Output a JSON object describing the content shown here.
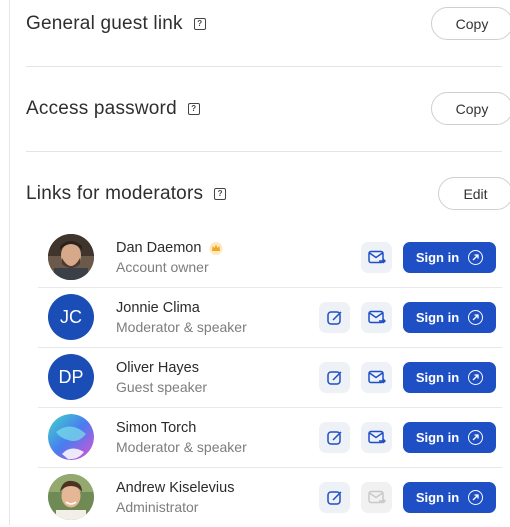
{
  "sections": {
    "guest_link": {
      "title": "General guest link",
      "help": "?",
      "button": "Copy"
    },
    "password": {
      "title": "Access password",
      "help": "?",
      "button": "Copy"
    },
    "moderators": {
      "title": "Links for moderators",
      "help": "?",
      "button": "Edit"
    }
  },
  "sign_in_label": "Sign in",
  "moderators": [
    {
      "name": "Dan Daemon",
      "role": "Account owner",
      "avatar": "photo",
      "initials": "",
      "owner_crown": true
    },
    {
      "name": "Jonnie Clima",
      "role": "Moderator & speaker",
      "avatar": "initials",
      "initials": "JC"
    },
    {
      "name": "Oliver Hayes",
      "role": "Guest speaker",
      "avatar": "initials",
      "initials": "DP"
    },
    {
      "name": "Simon Torch",
      "role": "Moderator & speaker",
      "avatar": "gradient",
      "initials": ""
    },
    {
      "name": "Andrew Kiselevius",
      "role": "Administrator",
      "avatar": "photo",
      "initials": ""
    }
  ],
  "colors": {
    "accent": "#1f4fc5",
    "avatar_blue": "#1a4db5",
    "icon_bg": "#eef1f6"
  },
  "icons": [
    "help-icon",
    "crown-icon",
    "edit-link-icon",
    "email-icon",
    "external-arrow-icon"
  ]
}
